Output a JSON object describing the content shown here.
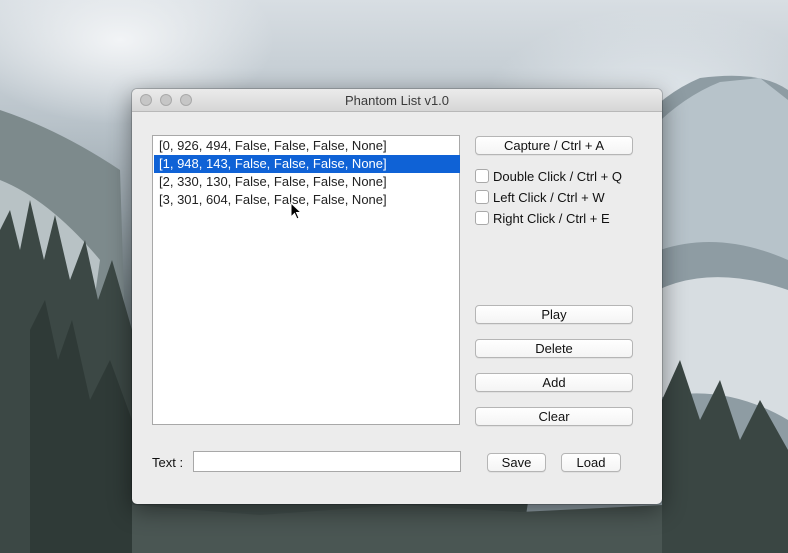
{
  "window": {
    "title": "Phantom List v1.0"
  },
  "list": {
    "items": [
      "[0, 926, 494, False, False, False, None]",
      "[1, 948, 143, False, False, False, None]",
      "[2, 330, 130, False, False, False, None]",
      "[3, 301, 604, False, False, False, None]"
    ],
    "selected_index": 1
  },
  "buttons": {
    "capture": "Capture / Ctrl + A",
    "play": "Play",
    "delete": "Delete",
    "add": "Add",
    "clear": "Clear",
    "save": "Save",
    "load": "Load"
  },
  "checkboxes": [
    {
      "label": "Double Click / Ctrl + Q",
      "checked": false
    },
    {
      "label": "Left Click / Ctrl + W",
      "checked": false
    },
    {
      "label": "Right Click / Ctrl + E",
      "checked": false
    }
  ],
  "text_field": {
    "label": "Text :",
    "value": ""
  },
  "colors": {
    "selection": "#0f62d6",
    "window_bg": "#ececec"
  }
}
